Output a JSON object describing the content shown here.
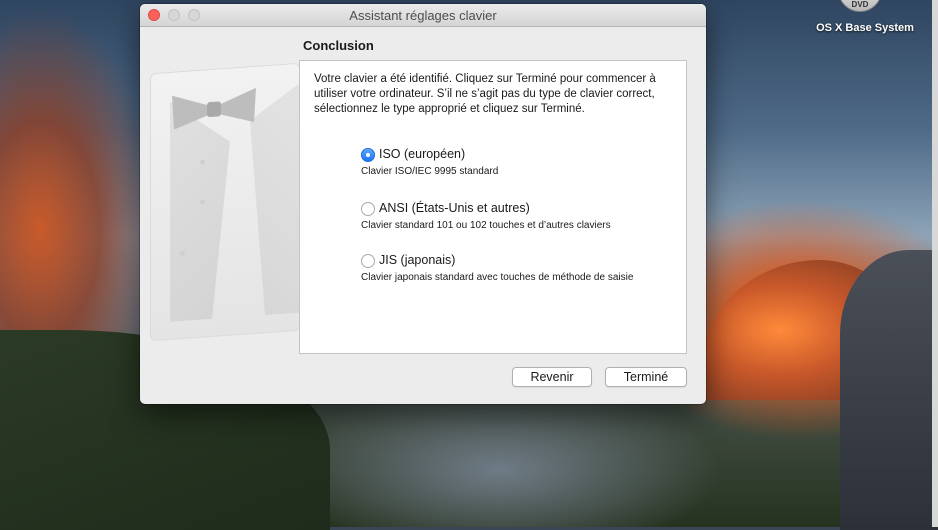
{
  "desktop": {
    "disk_icon_text": "DVD",
    "disk_label": "OS X Base System"
  },
  "window": {
    "title": "Assistant réglages clavier"
  },
  "content": {
    "section_title": "Conclusion",
    "message": "Votre clavier a été identifié. Cliquez sur Terminé pour commencer à utiliser votre ordinateur. S’il ne s’agit pas du type de clavier correct, sélectionnez le type approprié et cliquez sur Terminé.",
    "options": [
      {
        "label": "ISO (européen)",
        "description": "Clavier ISO/IEC 9995 standard",
        "selected": true
      },
      {
        "label": "ANSI (États-Unis et autres)",
        "description": "Clavier standard 101 ou 102 touches et d’autres claviers",
        "selected": false
      },
      {
        "label": "JIS (japonais)",
        "description": "Clavier japonais standard avec touches de méthode de saisie",
        "selected": false
      }
    ]
  },
  "buttons": {
    "back": "Revenir",
    "done": "Terminé"
  },
  "colors": {
    "accent": "#1c74f2",
    "close": "#fc605c",
    "window_bg": "#ececec"
  }
}
